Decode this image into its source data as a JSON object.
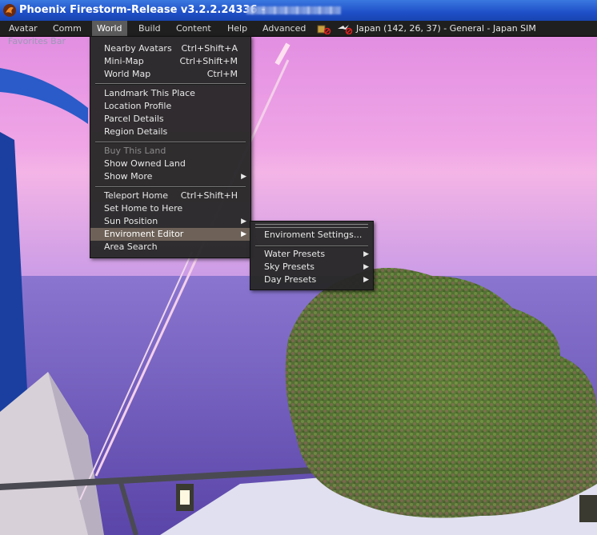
{
  "window": {
    "title": "Phoenix Firestorm-Release v3.2.2.24336 -",
    "app_icon": "phoenix-logo-icon"
  },
  "menubar": {
    "items": [
      "Avatar",
      "Comm",
      "World",
      "Build",
      "Content",
      "Help",
      "Advanced"
    ],
    "open_item": "World",
    "location": "Japan (142, 26, 37) - General - Japan SIM"
  },
  "favorites_bar": {
    "label": "Favorites Bar"
  },
  "world_menu": {
    "groups": [
      [
        {
          "label": "Nearby Avatars",
          "shortcut": "Ctrl+Shift+A"
        },
        {
          "label": "Mini-Map",
          "shortcut": "Ctrl+Shift+M"
        },
        {
          "label": "World Map",
          "shortcut": "Ctrl+M"
        }
      ],
      [
        {
          "label": "Landmark This Place"
        },
        {
          "label": "Location Profile"
        },
        {
          "label": "Parcel Details"
        },
        {
          "label": "Region Details"
        }
      ],
      [
        {
          "label": "Buy This Land",
          "disabled": true
        },
        {
          "label": "Show Owned Land"
        },
        {
          "label": "Show More",
          "submenu": true
        }
      ],
      [
        {
          "label": "Teleport Home",
          "shortcut": "Ctrl+Shift+H"
        },
        {
          "label": "Set Home to Here"
        },
        {
          "label": "Sun Position",
          "submenu": true
        },
        {
          "label": "Enviroment Editor",
          "submenu": true,
          "highlighted": true
        },
        {
          "label": "Area Search"
        }
      ]
    ]
  },
  "env_submenu": {
    "items": [
      {
        "label": "Enviroment Settings..."
      },
      {
        "label": "Water Presets",
        "submenu": true
      },
      {
        "label": "Sky Presets",
        "submenu": true
      },
      {
        "label": "Day Presets",
        "submenu": true
      }
    ]
  },
  "colors": {
    "menu_bg": "#282828",
    "highlight": "#6e6258",
    "titlebar": "#1f4fc8",
    "sky_top": "#e48de0",
    "sea": "#7a62c0"
  }
}
